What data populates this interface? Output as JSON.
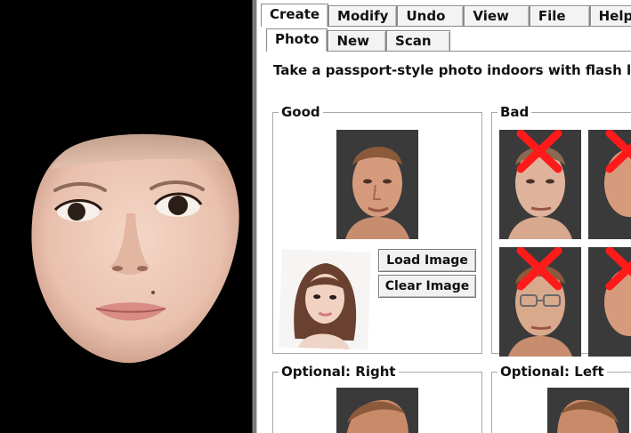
{
  "viewport": {
    "background": "#000000",
    "subject": "3d-face-model"
  },
  "tabs": {
    "top": [
      {
        "label": "Create",
        "active": true
      },
      {
        "label": "Modify",
        "active": false
      },
      {
        "label": "Undo",
        "active": false
      },
      {
        "label": "View",
        "active": false
      },
      {
        "label": "File",
        "active": false
      },
      {
        "label": "Help",
        "active": false
      }
    ],
    "sub": [
      {
        "label": "Photo",
        "active": true
      },
      {
        "label": "New",
        "active": false
      },
      {
        "label": "Scan",
        "active": false
      }
    ]
  },
  "instruction": "Take a passport-style photo indoors with flash lighting:",
  "groups": {
    "good": "Good",
    "bad": "Bad",
    "optional_right": "Optional: Right",
    "optional_left": "Optional: Left"
  },
  "buttons": {
    "load_image": "Load Image",
    "clear_image": "Clear Image"
  },
  "colors": {
    "reject_mark": "#ff1a1a",
    "panel_bg": "#ffffff"
  }
}
